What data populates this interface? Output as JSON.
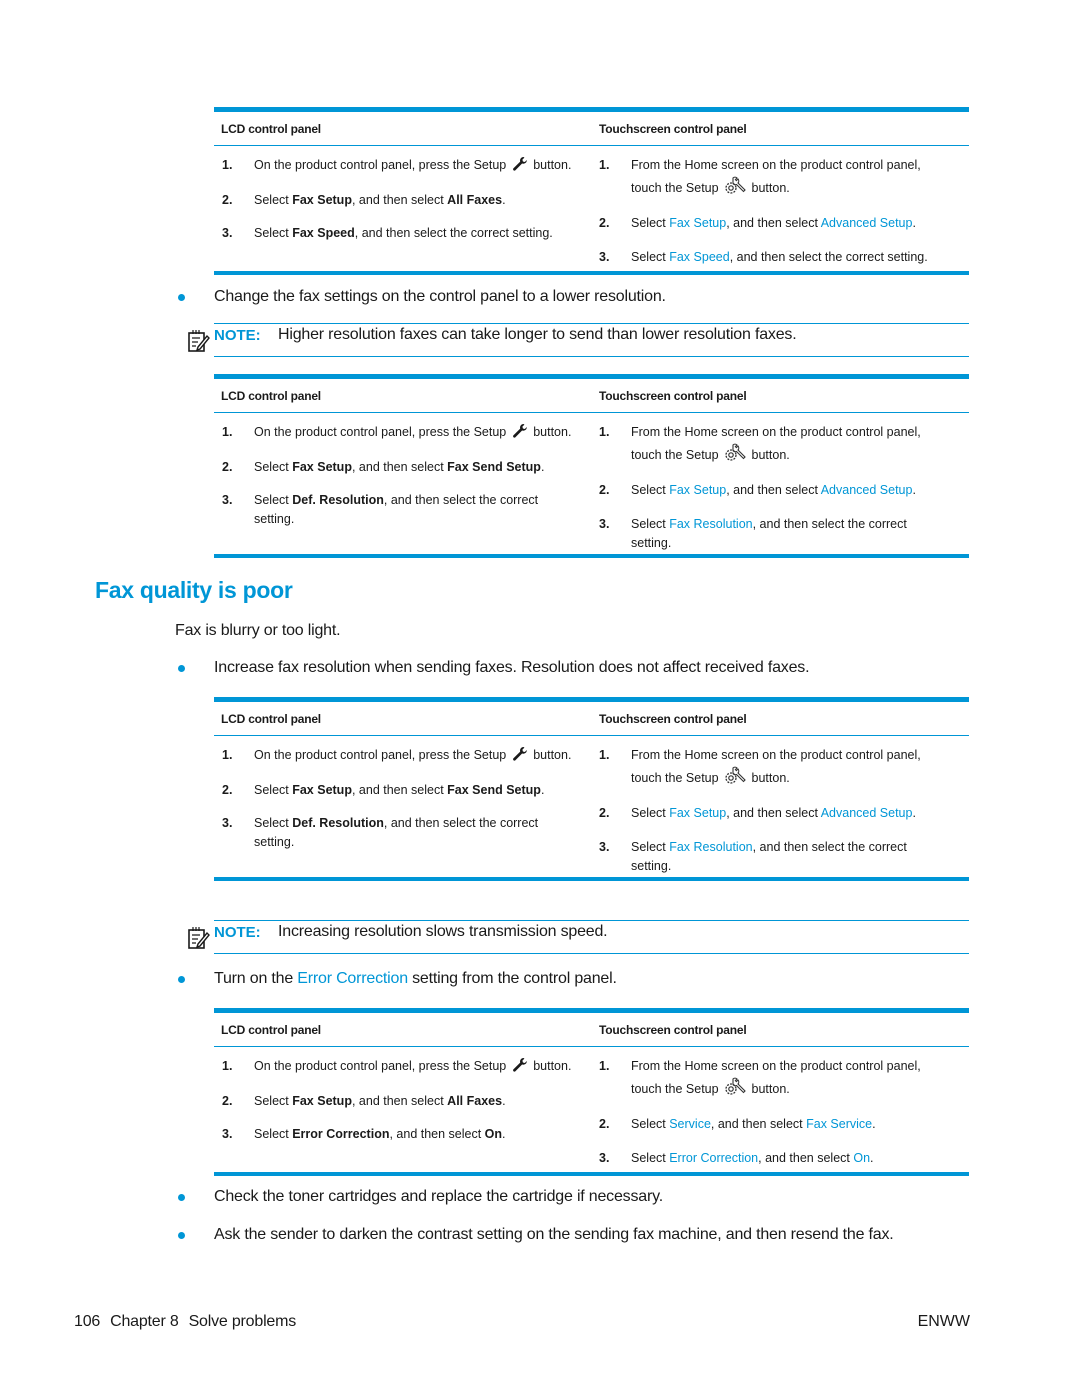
{
  "colors": {
    "accent": "#0096d6",
    "text": "#1a1a1a"
  },
  "table_headers": {
    "lcd": "LCD control panel",
    "touch": "Touchscreen control panel"
  },
  "tables": [
    {
      "lcd": [
        {
          "num": "1.",
          "parts": [
            {
              "t": "On the product control panel, press the Setup "
            },
            {
              "icon": "wrench-icon"
            },
            {
              "t": " button."
            }
          ]
        },
        {
          "num": "2.",
          "parts": [
            {
              "t": "Select "
            },
            {
              "b": "Fax Setup"
            },
            {
              "t": ", and then select "
            },
            {
              "b": "All Faxes"
            },
            {
              "t": "."
            }
          ]
        },
        {
          "num": "3.",
          "parts": [
            {
              "t": "Select "
            },
            {
              "b": "Fax Speed"
            },
            {
              "t": ", and then select the correct setting."
            }
          ]
        }
      ],
      "touch": [
        {
          "num": "1.",
          "lines": [
            [
              {
                "t": "From the Home screen on the product control panel,"
              }
            ],
            [
              {
                "t": "touch the Setup "
              },
              {
                "icon": "setup-gear-icon"
              },
              {
                "t": " button."
              }
            ]
          ]
        },
        {
          "num": "2.",
          "lines": [
            [
              {
                "t": "Select "
              },
              {
                "l": "Fax Setup"
              },
              {
                "t": ", and then select "
              },
              {
                "l": "Advanced Setup"
              },
              {
                "t": "."
              }
            ]
          ]
        },
        {
          "num": "3.",
          "lines": [
            [
              {
                "t": "Select "
              },
              {
                "l": "Fax Speed"
              },
              {
                "t": ", and then select the correct setting."
              }
            ]
          ]
        }
      ]
    },
    {
      "lcd": [
        {
          "num": "1.",
          "parts": [
            {
              "t": "On the product control panel, press the Setup "
            },
            {
              "icon": "wrench-icon"
            },
            {
              "t": " button."
            }
          ]
        },
        {
          "num": "2.",
          "parts": [
            {
              "t": "Select "
            },
            {
              "b": "Fax Setup"
            },
            {
              "t": ", and then select "
            },
            {
              "b": "Fax Send Setup"
            },
            {
              "t": "."
            }
          ]
        },
        {
          "num": "3.",
          "lines": [
            [
              {
                "t": "Select "
              },
              {
                "b": "Def. Resolution"
              },
              {
                "t": ", and then select the correct"
              }
            ],
            [
              {
                "t": "setting."
              }
            ]
          ]
        }
      ],
      "touch": [
        {
          "num": "1.",
          "lines": [
            [
              {
                "t": "From the Home screen on the product control panel,"
              }
            ],
            [
              {
                "t": "touch the Setup "
              },
              {
                "icon": "setup-gear-icon"
              },
              {
                "t": " button."
              }
            ]
          ]
        },
        {
          "num": "2.",
          "lines": [
            [
              {
                "t": "Select "
              },
              {
                "l": "Fax Setup"
              },
              {
                "t": ", and then select "
              },
              {
                "l": "Advanced Setup"
              },
              {
                "t": "."
              }
            ]
          ]
        },
        {
          "num": "3.",
          "lines": [
            [
              {
                "t": "Select "
              },
              {
                "l": "Fax Resolution"
              },
              {
                "t": ", and then select the correct"
              }
            ],
            [
              {
                "t": "setting."
              }
            ]
          ]
        }
      ]
    },
    {
      "lcd": [
        {
          "num": "1.",
          "parts": [
            {
              "t": "On the product control panel, press the Setup "
            },
            {
              "icon": "wrench-icon"
            },
            {
              "t": " button."
            }
          ]
        },
        {
          "num": "2.",
          "parts": [
            {
              "t": "Select "
            },
            {
              "b": "Fax Setup"
            },
            {
              "t": ", and then select "
            },
            {
              "b": "Fax Send Setup"
            },
            {
              "t": "."
            }
          ]
        },
        {
          "num": "3.",
          "lines": [
            [
              {
                "t": "Select "
              },
              {
                "b": "Def. Resolution"
              },
              {
                "t": ", and then select the correct"
              }
            ],
            [
              {
                "t": "setting."
              }
            ]
          ]
        }
      ],
      "touch": [
        {
          "num": "1.",
          "lines": [
            [
              {
                "t": "From the Home screen on the product control panel,"
              }
            ],
            [
              {
                "t": "touch the Setup "
              },
              {
                "icon": "setup-gear-icon"
              },
              {
                "t": " button."
              }
            ]
          ]
        },
        {
          "num": "2.",
          "lines": [
            [
              {
                "t": "Select "
              },
              {
                "l": "Fax Setup"
              },
              {
                "t": ", and then select "
              },
              {
                "l": "Advanced Setup"
              },
              {
                "t": "."
              }
            ]
          ]
        },
        {
          "num": "3.",
          "lines": [
            [
              {
                "t": "Select "
              },
              {
                "l": "Fax Resolution"
              },
              {
                "t": ", and then select the correct"
              }
            ],
            [
              {
                "t": "setting."
              }
            ]
          ]
        }
      ]
    },
    {
      "lcd": [
        {
          "num": "1.",
          "parts": [
            {
              "t": "On the product control panel, press the Setup "
            },
            {
              "icon": "wrench-icon"
            },
            {
              "t": " button."
            }
          ]
        },
        {
          "num": "2.",
          "parts": [
            {
              "t": "Select "
            },
            {
              "b": "Fax Setup"
            },
            {
              "t": ", and then select "
            },
            {
              "b": "All Faxes"
            },
            {
              "t": "."
            }
          ]
        },
        {
          "num": "3.",
          "parts": [
            {
              "t": "Select "
            },
            {
              "b": "Error Correction"
            },
            {
              "t": ", and then select "
            },
            {
              "b": "On"
            },
            {
              "t": "."
            }
          ]
        }
      ],
      "touch": [
        {
          "num": "1.",
          "lines": [
            [
              {
                "t": "From the Home screen on the product control panel,"
              }
            ],
            [
              {
                "t": "touch the Setup "
              },
              {
                "icon": "setup-gear-icon"
              },
              {
                "t": " button."
              }
            ]
          ]
        },
        {
          "num": "2.",
          "lines": [
            [
              {
                "t": "Select "
              },
              {
                "l": "Service"
              },
              {
                "t": ", and then select "
              },
              {
                "l": "Fax Service"
              },
              {
                "t": "."
              }
            ]
          ]
        },
        {
          "num": "3.",
          "lines": [
            [
              {
                "t": "Select "
              },
              {
                "l": "Error Correction"
              },
              {
                "t": ", and then select "
              },
              {
                "l": "On"
              },
              {
                "t": "."
              }
            ]
          ]
        }
      ]
    }
  ],
  "bullets": {
    "lower_resolution": "Change the fax settings on the control panel to a lower resolution.",
    "increase_resolution": "Increase fax resolution when sending faxes. Resolution does not affect received faxes.",
    "error_correction_prefix": "Turn on the ",
    "error_correction_link": "Error Correction",
    "error_correction_suffix": " setting from the control panel.",
    "toner": "Check the toner cartridges and replace the cartridge if necessary.",
    "sender_contrast": "Ask the sender to darken the contrast setting on the sending fax machine, and then resend the fax."
  },
  "notes": {
    "label": "NOTE:",
    "note1": "Higher resolution faxes can take longer to send than lower resolution faxes.",
    "note2": "Increasing resolution slows transmission speed."
  },
  "section": {
    "heading": "Fax quality is poor",
    "intro": "Fax is blurry or too light."
  },
  "footer": {
    "page_number": "106",
    "chapter": "Chapter 8",
    "chapter_title": "Solve problems",
    "locale": "ENWW"
  }
}
